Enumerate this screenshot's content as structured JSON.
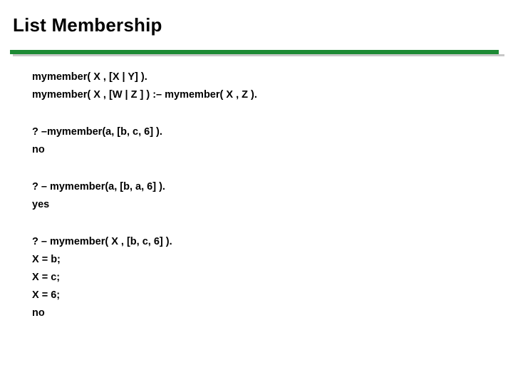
{
  "slide": {
    "title": "List Membership",
    "divider_color": "#1d8a34",
    "divider_shadow_color": "#c8c8c8",
    "groups": [
      {
        "name": "definition",
        "lines": [
          "mymember( X , [X | Y] ).",
          "mymember( X , [W | Z ] ) :– mymember( X , Z )."
        ]
      },
      {
        "name": "query-no",
        "lines": [
          "? –mymember(a, [b, c, 6] ).",
          "no"
        ]
      },
      {
        "name": "query-yes",
        "lines": [
          "? – mymember(a, [b, a, 6] ).",
          "yes"
        ]
      },
      {
        "name": "query-bindings",
        "lines": [
          "? – mymember( X , [b, c, 6] ).",
          "X = b;",
          "X = c;",
          "X = 6;",
          "no"
        ]
      }
    ]
  }
}
